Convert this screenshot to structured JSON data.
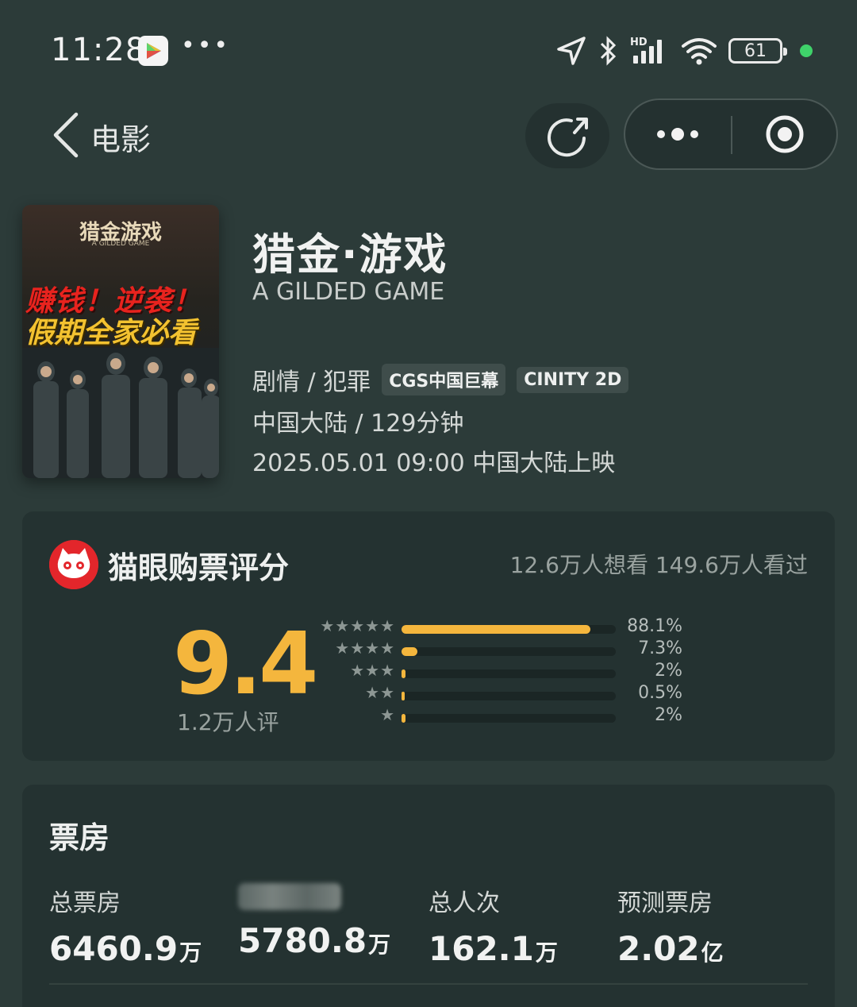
{
  "status_bar": {
    "time": "11:28",
    "battery": "61"
  },
  "nav": {
    "back_label": "电影"
  },
  "movie": {
    "title": "猎金·游戏",
    "english_title": "A GILDED GAME",
    "genre": "剧情 / 犯罪",
    "tags": [
      "CGS中国巨幕",
      "CINITY 2D"
    ],
    "region_duration": "中国大陆 / 129分钟",
    "release": "2025.05.01 09:00 中国大陆上映",
    "poster": {
      "title": "猎金游戏",
      "subtitle": "A GILDED GAME",
      "line1": "赚钱！逆袭！",
      "line2": "假期全家必看"
    }
  },
  "rating": {
    "title": "猫眼购票评分",
    "stats": "12.6万人想看 149.6万人看过",
    "score": "9.4",
    "count": "1.2万人评",
    "distribution": [
      {
        "stars": "★★★★★",
        "percent": "88.1%",
        "value": 88.1
      },
      {
        "stars": "★★★★",
        "percent": "7.3%",
        "value": 7.3
      },
      {
        "stars": "★★★",
        "percent": "2%",
        "value": 2
      },
      {
        "stars": "★★",
        "percent": "0.5%",
        "value": 0.5
      },
      {
        "stars": "★",
        "percent": "2%",
        "value": 2
      }
    ]
  },
  "box_office": {
    "title": "票房",
    "items": [
      {
        "label": "总票房",
        "value": "6460.9",
        "unit": "万"
      },
      {
        "label": "",
        "value": "5780.8",
        "unit": "万"
      },
      {
        "label": "总人次",
        "value": "162.1",
        "unit": "万"
      },
      {
        "label": "预测票房",
        "value": "2.02",
        "unit": "亿"
      }
    ]
  },
  "colors": {
    "accent": "#f4b63d",
    "background": "#2c3b39",
    "card": "#243231",
    "maoyan_red": "#e3262b"
  }
}
